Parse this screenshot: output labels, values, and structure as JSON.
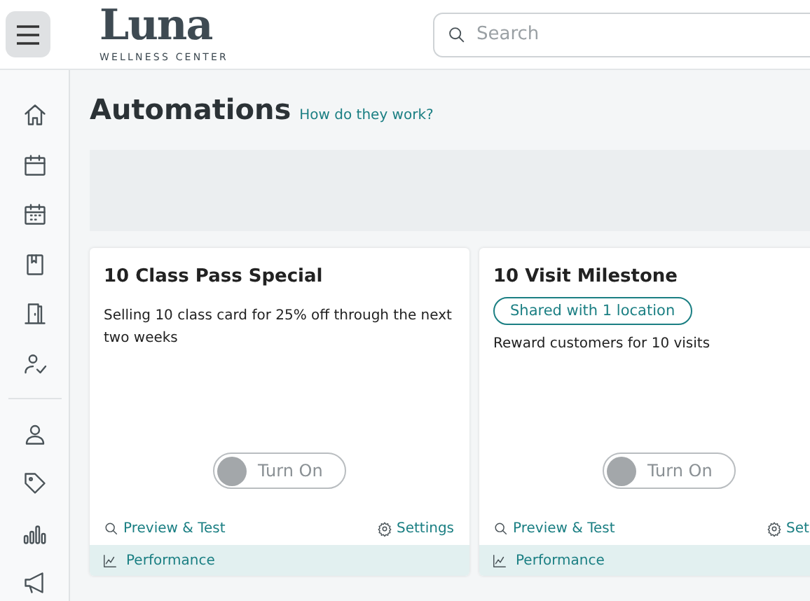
{
  "header": {
    "logo": "Luna",
    "logo_subtitle": "WELLNESS CENTER",
    "search": {
      "placeholder": "Search"
    }
  },
  "sidebar": {
    "items": [
      {
        "kind": "home"
      },
      {
        "kind": "calendar"
      },
      {
        "kind": "schedule"
      },
      {
        "kind": "book"
      },
      {
        "kind": "door"
      },
      {
        "kind": "staff"
      },
      {
        "kind": "divider"
      },
      {
        "kind": "person"
      },
      {
        "kind": "tag"
      },
      {
        "kind": "chart"
      },
      {
        "kind": "megaphone"
      }
    ]
  },
  "page": {
    "title": "Automations",
    "help_link": "How do they work?"
  },
  "cards": [
    {
      "title": "10 Class Pass Special",
      "description": "Selling 10 class card for 25% off through the next two weeks",
      "toggle": {
        "label": "Turn On",
        "on": false
      },
      "preview": "Preview & Test",
      "settings": "Settings",
      "performance": "Performance"
    },
    {
      "title": "10 Visit Milestone",
      "tag": "Shared with 1 location",
      "description": "Reward customers for 10 visits",
      "toggle": {
        "label": "Turn On",
        "on": false
      },
      "preview": "Preview & Test",
      "settings": "Set",
      "performance": "Performance"
    }
  ]
}
